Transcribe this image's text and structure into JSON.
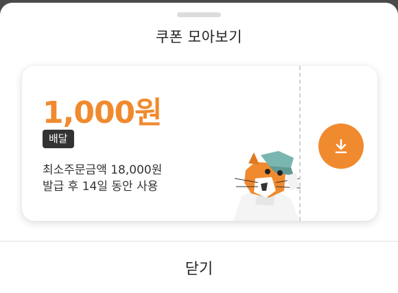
{
  "sheet": {
    "title": "쿠폰 모아보기",
    "close_label": "닫기"
  },
  "coupon": {
    "amount": "1,000원",
    "badge": "배달",
    "min_order": "최소주문금액 18,000원",
    "validity": "발급 후 14일 동안 사용",
    "download_icon": "download-icon",
    "mascot": "cat-mascot-illustration"
  },
  "colors": {
    "accent": "#f08a2e",
    "badge_bg": "#333333"
  }
}
